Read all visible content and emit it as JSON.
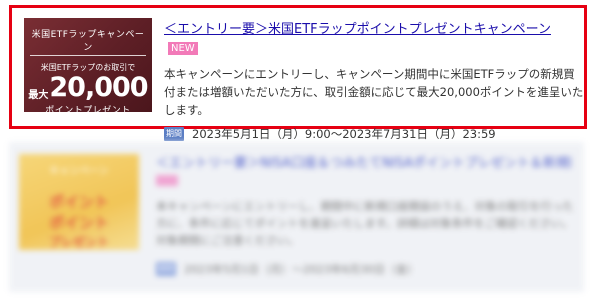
{
  "campaign1": {
    "banner": {
      "top_text": "米国ETFラップキャンペーン",
      "mid_text": "米国ETFラップのお取引で",
      "amount_prefix": "最大",
      "amount": "20,000",
      "bottom_text": "ポイントプレゼント",
      "bg_color": "#5e1f26"
    },
    "title": "＜エントリー要＞米国ETFラップポイントプレゼントキャンペーン",
    "badge": "NEW",
    "description": "本キャンペーンにエントリーし、キャンペーン期間中に米国ETFラップの新規買付または増額いただいた方に、取引金額に応じて最大20,000ポイントを進呈いたします。",
    "period_icon": "期間",
    "period": "2023年5月1日（月）9:00～2023年7月31日（月）23:59",
    "highlight_color": "#e60012"
  },
  "campaign2": {
    "banner": {
      "top_text": "キャンペーン",
      "line1": "ポイント",
      "line2": "ポイント",
      "line3": "プレゼント"
    },
    "title": "＜エントリー要＞NISA口座＆つみたてNISAポイントプレゼント＆新規開設キャンペーン",
    "description": "本キャンペーンにエントリーし、期間中に新規口座開設のうえ、対象の取引を行った方に、条件に応じてポイントを進呈いたします。詳細は対象条件をご確認ください。対象期間にご注意ください。",
    "period_icon": "期間",
    "period": "2023年5月1日（月）～2023年6月30日（金）"
  }
}
